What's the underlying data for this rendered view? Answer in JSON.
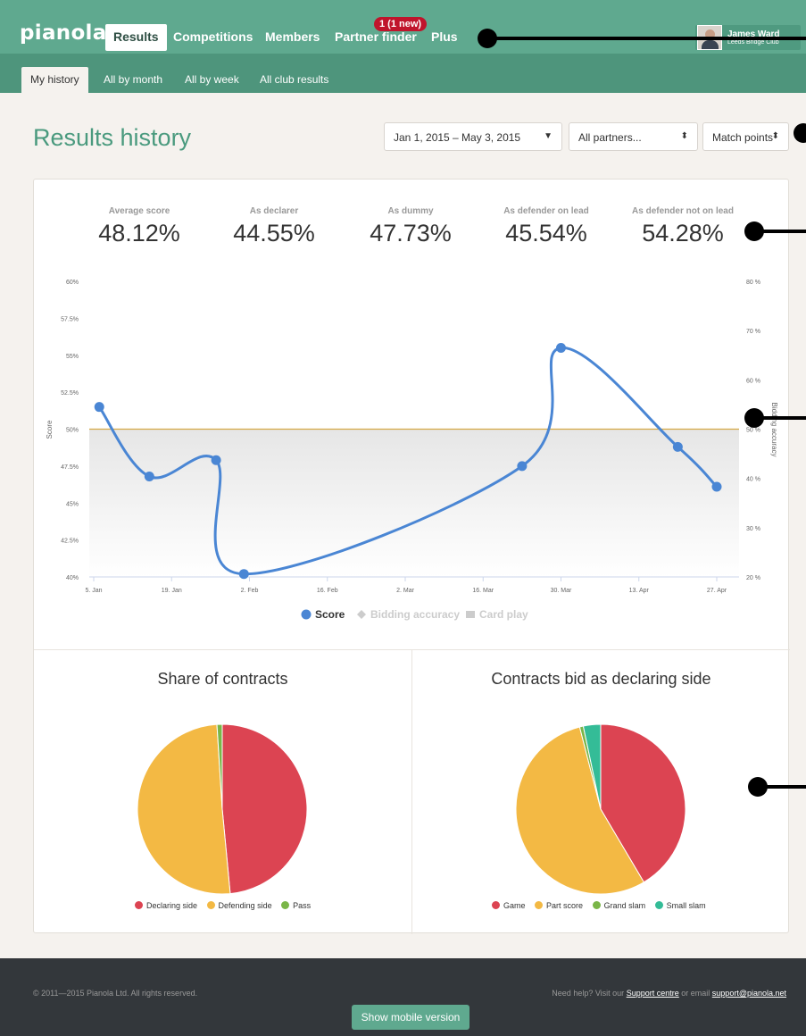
{
  "topnav": {
    "logo": "pianola",
    "items": [
      {
        "label": "Results",
        "active": true
      },
      {
        "label": "Competitions"
      },
      {
        "label": "Members"
      },
      {
        "label": "Partner finder"
      },
      {
        "label": "Plus"
      }
    ],
    "notification_badge": "1 (1 new)",
    "user": {
      "name": "James Ward",
      "club": "Leeds Bridge Club"
    }
  },
  "subnav": {
    "items": [
      {
        "label": "My history",
        "active": true
      },
      {
        "label": "All by month"
      },
      {
        "label": "All by week"
      },
      {
        "label": "All club results"
      }
    ]
  },
  "page": {
    "title": "Results history",
    "filters": {
      "date_range": "Jan 1, 2015 – May 3, 2015",
      "partners": "All partners...",
      "scoring": "Match points"
    }
  },
  "stats": [
    {
      "label": "Average score",
      "value": "48.12%"
    },
    {
      "label": "As declarer",
      "value": "44.55%"
    },
    {
      "label": "As dummy",
      "value": "47.73%"
    },
    {
      "label": "As defender on lead",
      "value": "45.54%"
    },
    {
      "label": "As defender not on lead",
      "value": "54.28%"
    }
  ],
  "chart_data": [
    {
      "type": "line",
      "title": "",
      "xlabel": "",
      "ylabel": "Score",
      "y2label": "Bidding accuracy",
      "x_ticks": [
        "5. Jan",
        "19. Jan",
        "2. Feb",
        "16. Feb",
        "2. Mar",
        "16. Mar",
        "30. Mar",
        "13. Apr",
        "27. Apr"
      ],
      "ylim": [
        40,
        60
      ],
      "y_ticks": [
        "40%",
        "42.5%",
        "45%",
        "47.5%",
        "50%",
        "52.5%",
        "55%",
        "57.5%",
        "60%"
      ],
      "y2lim": [
        20,
        80
      ],
      "y2_ticks": [
        "20 %",
        "30 %",
        "40 %",
        "50 %",
        "60 %",
        "70 %",
        "80 %"
      ],
      "reference_line": 50,
      "reference_color": "#d4a843",
      "series": [
        {
          "name": "Score",
          "color": "#4a86d4",
          "x": [
            "2015-01-06",
            "2015-01-15",
            "2015-01-27",
            "2015-02-01",
            "2015-03-23",
            "2015-03-30",
            "2015-04-20",
            "2015-04-27"
          ],
          "y": [
            51.5,
            46.8,
            47.9,
            40.2,
            47.5,
            55.5,
            48.8,
            46.1
          ]
        }
      ],
      "legend": [
        {
          "name": "Score",
          "active": true
        },
        {
          "name": "Bidding accuracy",
          "active": false
        },
        {
          "name": "Card play",
          "active": false
        }
      ],
      "legend_position": "bottom",
      "grid": false
    },
    {
      "type": "pie",
      "title": "Share of contracts",
      "slices": [
        {
          "name": "Declaring side",
          "value": 48.5,
          "color": "#dc4452"
        },
        {
          "name": "Defending side",
          "value": 50.5,
          "color": "#f3b944"
        },
        {
          "name": "Pass",
          "value": 1.0,
          "color": "#7ab648"
        }
      ],
      "legend_position": "bottom"
    },
    {
      "type": "pie",
      "title": "Contracts bid as declaring side",
      "slices": [
        {
          "name": "Game",
          "value": 41.5,
          "color": "#dc4452"
        },
        {
          "name": "Part score",
          "value": 54.5,
          "color": "#f3b944"
        },
        {
          "name": "Grand slam",
          "value": 0.7,
          "color": "#7ab648"
        },
        {
          "name": "Small slam",
          "value": 3.3,
          "color": "#34bc97"
        }
      ],
      "legend_position": "bottom"
    }
  ],
  "footer": {
    "copyright": "© 2011—2015 Pianola Ltd. All rights reserved.",
    "help_prefix": "Need help? Visit our",
    "support_link": "Support centre",
    "help_middle": "or email",
    "email": "support@pianola.net",
    "mobile_button": "Show mobile version"
  }
}
